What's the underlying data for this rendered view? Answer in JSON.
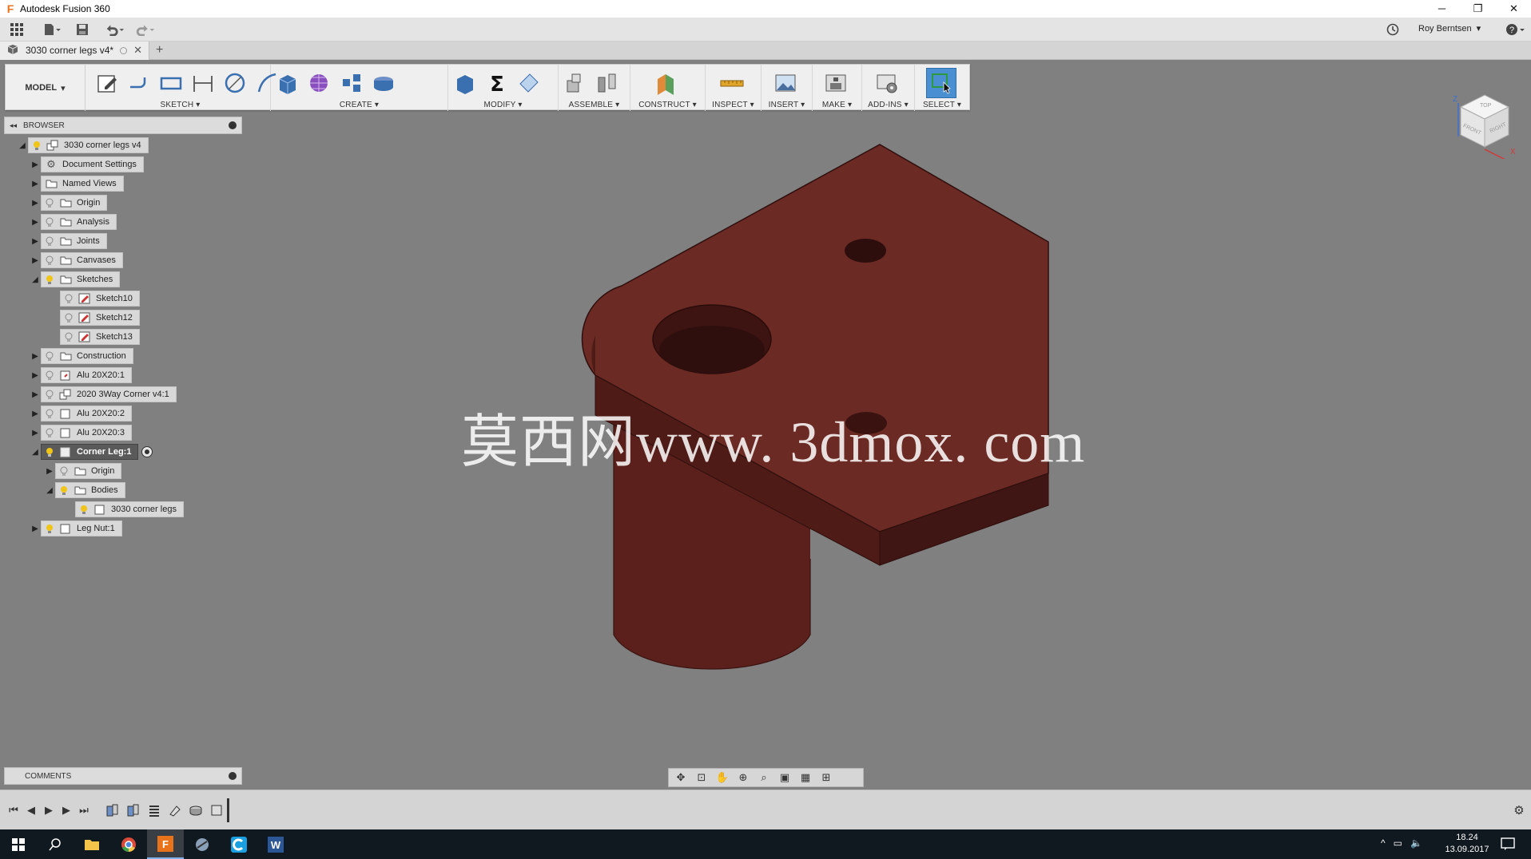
{
  "app": {
    "title": "Autodesk Fusion 360"
  },
  "window_controls": {
    "minimize": "─",
    "restore": "❐",
    "close": "✕"
  },
  "quick_access": {
    "user": "Roy Berntsen"
  },
  "document_tab": {
    "title": "3030 corner legs v4*",
    "add_tab": "+"
  },
  "ribbon": {
    "workspace": "MODEL",
    "groups": [
      {
        "label": "SKETCH"
      },
      {
        "label": "CREATE"
      },
      {
        "label": "MODIFY"
      },
      {
        "label": "ASSEMBLE"
      },
      {
        "label": "CONSTRUCT"
      },
      {
        "label": "INSPECT"
      },
      {
        "label": "INSERT"
      },
      {
        "label": "MAKE"
      },
      {
        "label": "ADD-INS"
      },
      {
        "label": "SELECT"
      }
    ]
  },
  "browser": {
    "header": "BROWSER",
    "nodes": [
      {
        "label": "3030 corner legs v4"
      },
      {
        "label": "Document Settings"
      },
      {
        "label": "Named Views"
      },
      {
        "label": "Origin"
      },
      {
        "label": "Analysis"
      },
      {
        "label": "Joints"
      },
      {
        "label": "Canvases"
      },
      {
        "label": "Sketches"
      },
      {
        "label": "Sketch10"
      },
      {
        "label": "Sketch12"
      },
      {
        "label": "Sketch13"
      },
      {
        "label": "Construction"
      },
      {
        "label": "Alu 20X20:1"
      },
      {
        "label": "2020 3Way Corner v4:1"
      },
      {
        "label": "Alu 20X20:2"
      },
      {
        "label": "Alu 20X20:3"
      },
      {
        "label": "Corner Leg:1"
      },
      {
        "label": "Origin"
      },
      {
        "label": "Bodies"
      },
      {
        "label": "3030 corner legs"
      },
      {
        "label": "Leg Nut:1"
      }
    ]
  },
  "comments": {
    "header": "COMMENTS"
  },
  "viewcube": {
    "top": "TOP",
    "front": "FRONT",
    "right": "RIGHT",
    "axis_z": "Z",
    "axis_x": "X"
  },
  "watermark": "莫西网www. 3dmox. com",
  "taskbar": {
    "time": "18.24",
    "date": "13.09.2017"
  },
  "colors": {
    "model_face_top": "#6c2a24",
    "model_face_side": "#4a1a16",
    "model_face_cyl": "#5b201b",
    "active_node": "#5a5a5a",
    "select_accent": "#4a8fd1"
  }
}
